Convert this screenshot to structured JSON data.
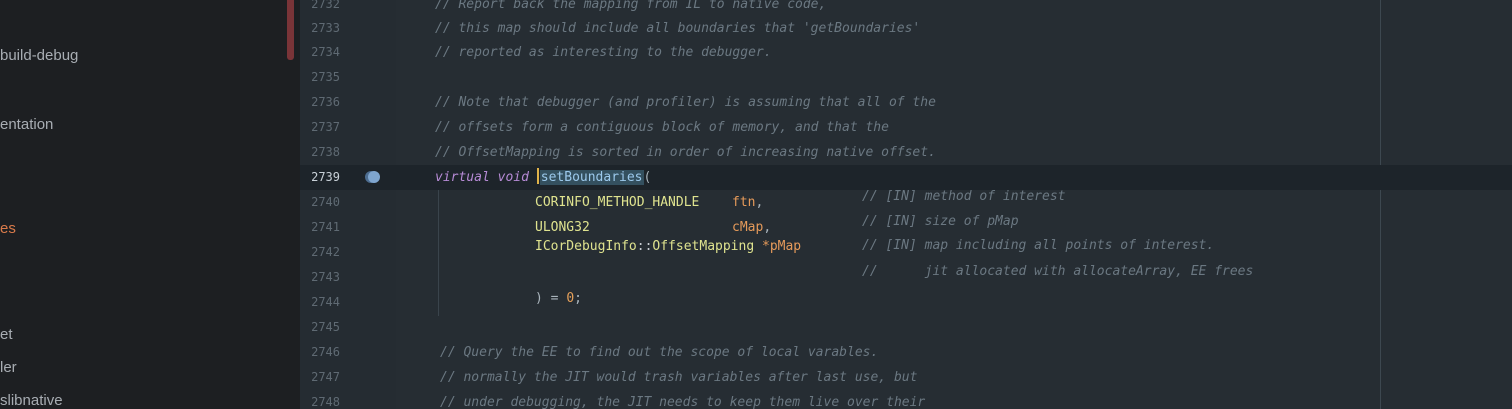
{
  "sidebar": {
    "items": [
      {
        "label": "build-debug",
        "active": false
      },
      {
        "label": "entation",
        "active": false
      },
      {
        "label": "es",
        "active": true
      },
      {
        "label": "et",
        "active": false
      },
      {
        "label": "ler",
        "active": false
      },
      {
        "label": "slibnative",
        "active": false
      }
    ]
  },
  "editor": {
    "current_line": "2739",
    "lines": [
      {
        "n": "2732",
        "text": "// Report back the mapping from IL to native code,"
      },
      {
        "n": "2733",
        "text": "// this map should include all boundaries that 'getBoundaries'"
      },
      {
        "n": "2734",
        "text": "// reported as interesting to the debugger."
      },
      {
        "n": "2735",
        "text": ""
      },
      {
        "n": "2736",
        "text": "// Note that debugger (and profiler) is assuming that all of the"
      },
      {
        "n": "2737",
        "text": "// offsets form a contiguous block of memory, and that the"
      },
      {
        "n": "2738",
        "text": "// OffsetMapping is sorted in order of increasing native offset."
      },
      {
        "n": "2739",
        "kw1": "virtual",
        "kw2": "void",
        "fn": "setBoundaries",
        "open": "("
      },
      {
        "n": "2740",
        "type": "CORINFO_METHOD_HANDLE",
        "param": "ftn",
        "comma": ",",
        "comment": "// [IN] method of interest"
      },
      {
        "n": "2741",
        "type": "ULONG32",
        "param": "cMap",
        "comma": ",",
        "comment": "// [IN] size of pMap"
      },
      {
        "n": "2742",
        "type": "ICorDebugInfo",
        "sep": "::",
        "type2": "OffsetMapping",
        "star": "*",
        "param": "pMap",
        "comment": "// [IN] map including all points of interest."
      },
      {
        "n": "2743",
        "comment": "//      jit allocated with allocateArray, EE frees"
      },
      {
        "n": "2744",
        "close": ") = ",
        "num": "0",
        "semi": ";"
      },
      {
        "n": "2745",
        "text": ""
      },
      {
        "n": "2746",
        "text": "// Query the EE to find out the scope of local varables."
      },
      {
        "n": "2747",
        "text": "// normally the JIT would trash variables after last use, but"
      },
      {
        "n": "2748",
        "text": "// under debugging, the JIT needs to keep them live over their"
      }
    ]
  },
  "colors": {
    "background": "#262d33",
    "comment": "#6b7882",
    "keyword": "#b78bd6",
    "type": "#dfe38f",
    "parameter": "#e59a5a",
    "selection": "#34505f",
    "active_sidebar": "#d97a4a"
  },
  "icons": {
    "breakpoint": "breakpoint-icon"
  }
}
